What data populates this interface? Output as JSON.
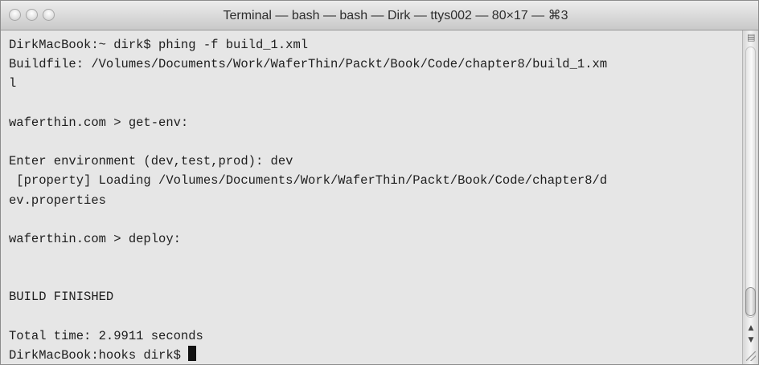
{
  "window": {
    "title": "Terminal — bash — bash — Dirk — ttys002 — 80×17 — ⌘3"
  },
  "terminal": {
    "lines": [
      "DirkMacBook:~ dirk$ phing -f build_1.xml",
      "Buildfile: /Volumes/Documents/Work/WaferThin/Packt/Book/Code/chapter8/build_1.xm",
      "l",
      "",
      "waferthin.com > get-env:",
      "",
      "Enter environment (dev,test,prod): dev",
      " [property] Loading /Volumes/Documents/Work/WaferThin/Packt/Book/Code/chapter8/d",
      "ev.properties",
      "",
      "waferthin.com > deploy:",
      "",
      "",
      "BUILD FINISHED",
      "",
      "Total time: 2.9911 seconds",
      "DirkMacBook:hooks dirk$ "
    ]
  },
  "icons": {
    "split_pane": "split-pane-icon",
    "scroll_up": "chevron-up-icon",
    "scroll_down": "chevron-down-icon",
    "resize": "resize-grip-icon"
  }
}
